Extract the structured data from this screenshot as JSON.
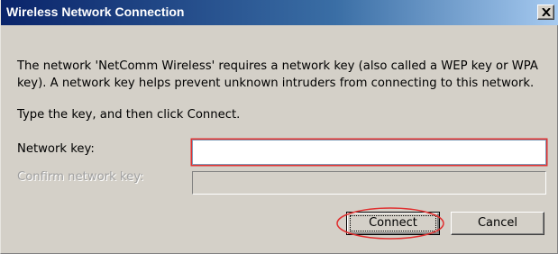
{
  "window": {
    "title": "Wireless Network Connection",
    "close_label": "×"
  },
  "body": {
    "message": "The network 'NetComm Wireless' requires a network key (also called a WEP key or WPA key). A network key helps prevent unknown intruders from connecting to this network.",
    "instruction": "Type the key, and then click Connect."
  },
  "form": {
    "network_key_label": "Network key:",
    "network_key_value": "",
    "confirm_key_label": "Confirm network key:",
    "confirm_key_value": "",
    "confirm_enabled": false
  },
  "buttons": {
    "connect_label": "Connect",
    "cancel_label": "Cancel"
  },
  "colors": {
    "title_gradient_start": "#0a246a",
    "title_gradient_end": "#a6caf0",
    "dialog_face": "#d4d0c8",
    "annotation_red": "#e03030"
  },
  "icons": {
    "close": "close-icon"
  }
}
